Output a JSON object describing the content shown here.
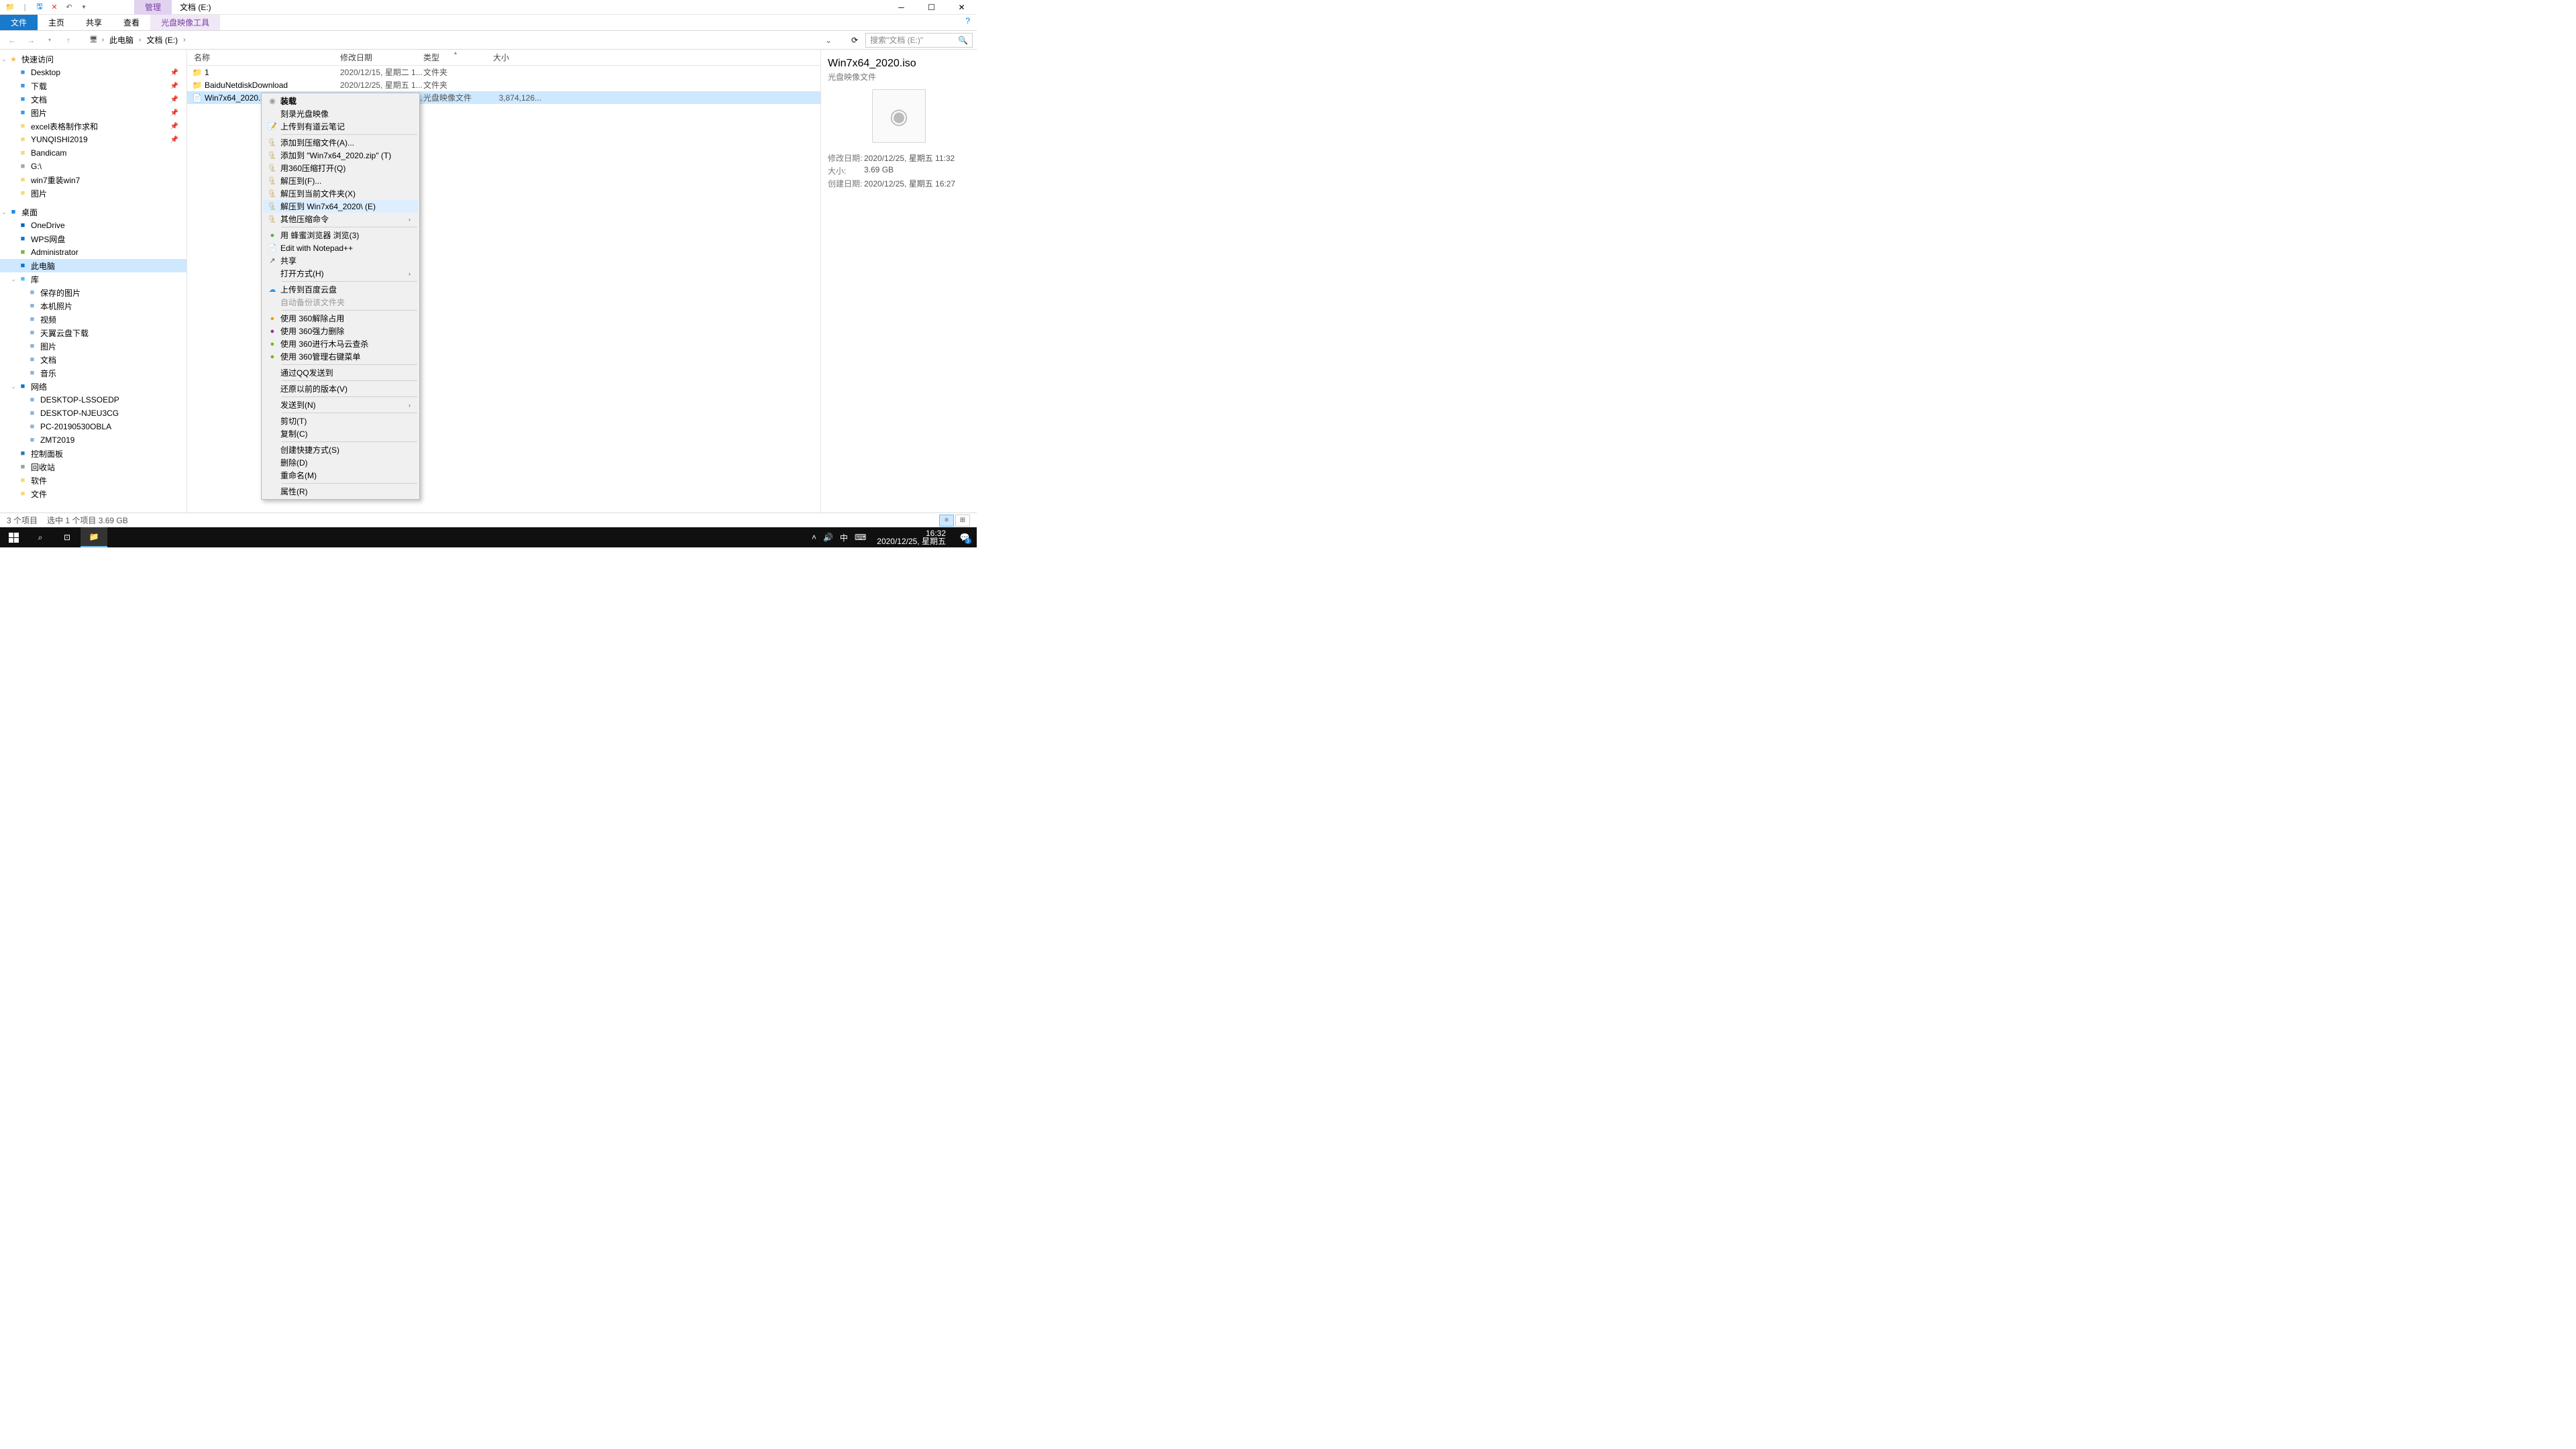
{
  "titlebar": {
    "context_tab": "管理",
    "title": "文档 (E:)"
  },
  "ribbon": {
    "tabs": [
      "文件",
      "主页",
      "共享",
      "查看"
    ],
    "context_tab": "光盘映像工具"
  },
  "breadcrumb": {
    "segments": [
      "此电脑",
      "文档 (E:)"
    ]
  },
  "search": {
    "placeholder": "搜索\"文档 (E:)\""
  },
  "sidebar": {
    "quick_access": {
      "label": "快速访问",
      "items": [
        {
          "label": "Desktop",
          "pinned": true,
          "color": "#3a99e9"
        },
        {
          "label": "下载",
          "pinned": true,
          "color": "#3a99e9"
        },
        {
          "label": "文档",
          "pinned": true,
          "color": "#3a99e9"
        },
        {
          "label": "图片",
          "pinned": true,
          "color": "#3a99e9"
        },
        {
          "label": "excel表格制作求和",
          "pinned": true,
          "color": "#f8d877"
        },
        {
          "label": "YUNQISHI2019",
          "pinned": true,
          "color": "#f8d877"
        },
        {
          "label": "Bandicam",
          "pinned": false,
          "color": "#f8d877"
        },
        {
          "label": "G:\\",
          "pinned": false,
          "color": "#9aa7b0"
        },
        {
          "label": "win7重装win7",
          "pinned": false,
          "color": "#f8d877"
        },
        {
          "label": "图片",
          "pinned": false,
          "color": "#f8d877"
        }
      ]
    },
    "desktop": {
      "label": "桌面",
      "items": [
        {
          "label": "OneDrive",
          "color": "#0364b8"
        },
        {
          "label": "WPS网盘",
          "color": "#0078d4"
        },
        {
          "label": "Administrator",
          "color": "#7cb342"
        },
        {
          "label": "此电脑",
          "color": "#0078d4",
          "selected": true
        },
        {
          "label": "库",
          "color": "#4fc3f7",
          "expandable": true,
          "children": [
            {
              "label": "保存的图片"
            },
            {
              "label": "本机照片"
            },
            {
              "label": "视频"
            },
            {
              "label": "天翼云盘下载"
            },
            {
              "label": "图片"
            },
            {
              "label": "文档"
            },
            {
              "label": "音乐"
            }
          ]
        },
        {
          "label": "网络",
          "color": "#0078d4",
          "expandable": true,
          "children": [
            {
              "label": "DESKTOP-LSSOEDP"
            },
            {
              "label": "DESKTOP-NJEU3CG"
            },
            {
              "label": "PC-20190530OBLA"
            },
            {
              "label": "ZMT2019"
            }
          ]
        },
        {
          "label": "控制面板",
          "color": "#2a7ab0"
        },
        {
          "label": "回收站",
          "color": "#9e9e9e"
        },
        {
          "label": "软件",
          "color": "#f8d877"
        },
        {
          "label": "文件",
          "color": "#f8d877"
        }
      ]
    }
  },
  "columns": {
    "name": "名称",
    "date": "修改日期",
    "type": "类型",
    "size": "大小"
  },
  "files": [
    {
      "icon": "folder",
      "name": "1",
      "date": "2020/12/15, 星期二 1...",
      "type": "文件夹",
      "size": ""
    },
    {
      "icon": "folder",
      "name": "BaiduNetdiskDownload",
      "date": "2020/12/25, 星期五 1...",
      "type": "文件夹",
      "size": ""
    },
    {
      "icon": "iso",
      "name": "Win7x64_2020.iso",
      "date": "2020/12/25, 星期五 1...",
      "type": "光盘映像文件",
      "size": "3,874,126...",
      "selected": true
    }
  ],
  "details": {
    "title": "Win7x64_2020.iso",
    "type": "光盘映像文件",
    "rows": [
      {
        "key": "修改日期:",
        "val": "2020/12/25, 星期五 11:32"
      },
      {
        "key": "大小:",
        "val": "3.69 GB"
      },
      {
        "key": "创建日期:",
        "val": "2020/12/25, 星期五 16:27"
      }
    ]
  },
  "context_menu": {
    "groups": [
      [
        {
          "label": "装载",
          "bold": true,
          "icon": "disc"
        },
        {
          "label": "刻录光盘映像"
        },
        {
          "label": "上传到有道云笔记",
          "icon": "note-blue"
        }
      ],
      [
        {
          "label": "添加到压缩文件(A)...",
          "icon": "archive"
        },
        {
          "label": "添加到 \"Win7x64_2020.zip\" (T)",
          "icon": "archive"
        },
        {
          "label": "用360压缩打开(Q)",
          "icon": "archive"
        },
        {
          "label": "解压到(F)...",
          "icon": "archive"
        },
        {
          "label": "解压到当前文件夹(X)",
          "icon": "archive"
        },
        {
          "label": "解压到 Win7x64_2020\\ (E)",
          "icon": "archive",
          "highlight": true
        },
        {
          "label": "其他压缩命令",
          "icon": "archive",
          "submenu": true
        }
      ],
      [
        {
          "label": "用 蜂蜜浏览器 浏览(3)",
          "icon": "green-dot"
        },
        {
          "label": "Edit with Notepad++",
          "icon": "npp"
        },
        {
          "label": "共享",
          "icon": "share"
        },
        {
          "label": "打开方式(H)",
          "submenu": true
        }
      ],
      [
        {
          "label": "上传到百度云盘",
          "icon": "cloud"
        },
        {
          "label": "自动备份该文件夹",
          "disabled": true
        }
      ],
      [
        {
          "label": "使用 360解除占用",
          "icon": "360-orange"
        },
        {
          "label": "使用 360强力删除",
          "icon": "360-purple"
        },
        {
          "label": "使用 360进行木马云查杀",
          "icon": "360-green"
        },
        {
          "label": "使用 360管理右键菜单",
          "icon": "360-green"
        }
      ],
      [
        {
          "label": "通过QQ发送到"
        }
      ],
      [
        {
          "label": "还原以前的版本(V)"
        }
      ],
      [
        {
          "label": "发送到(N)",
          "submenu": true
        }
      ],
      [
        {
          "label": "剪切(T)"
        },
        {
          "label": "复制(C)"
        }
      ],
      [
        {
          "label": "创建快捷方式(S)"
        },
        {
          "label": "删除(D)"
        },
        {
          "label": "重命名(M)"
        }
      ],
      [
        {
          "label": "属性(R)"
        }
      ]
    ]
  },
  "statusbar": {
    "count": "3 个项目",
    "selection": "选中 1 个项目  3.69 GB"
  },
  "taskbar": {
    "time": "16:32",
    "date": "2020/12/25, 星期五",
    "ime": "中",
    "notif_count": "3"
  }
}
